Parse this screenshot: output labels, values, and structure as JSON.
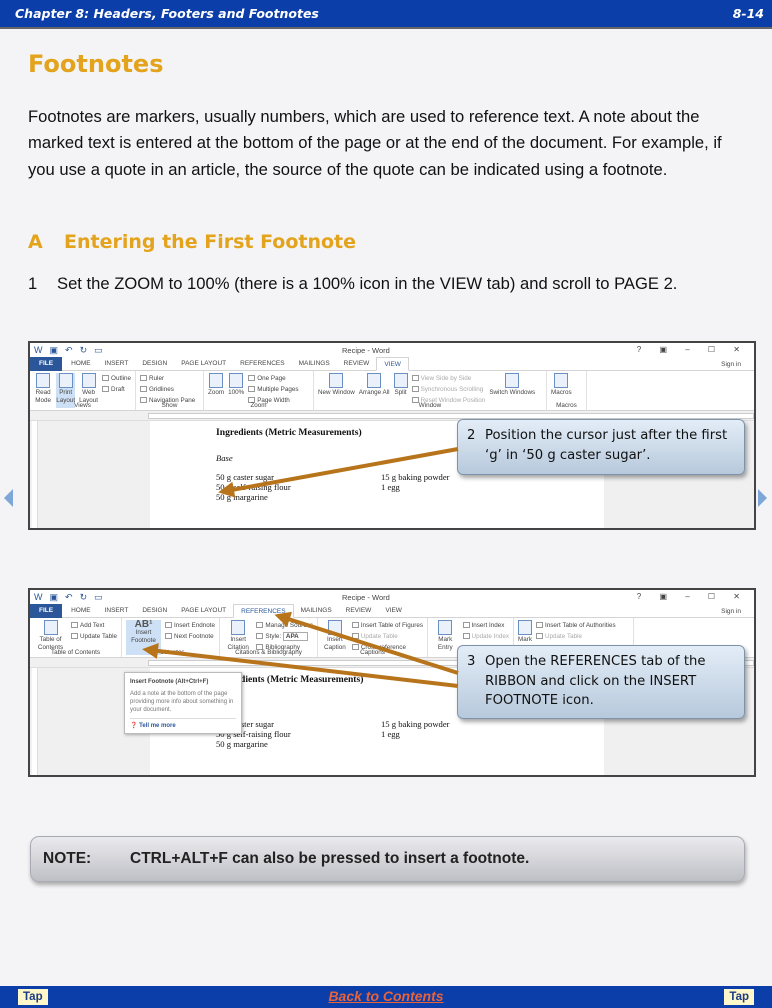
{
  "header": {
    "chapter": "Chapter 8: Headers, Footers and Footnotes",
    "page": "8-14"
  },
  "title": "Footnotes",
  "intro": "Footnotes are markers, usually numbers, which are used to reference text.  A note about the marked text is entered at the bottom of the page or at the end of the document.  For example, if you use a quote in an article, the source of the quote can be indicated using a footnote.",
  "section": {
    "letter": "A",
    "title": "Entering the First Footnote"
  },
  "step1": {
    "num": "1",
    "text": "Set the ZOOM to 100% (there is a 100% icon in the VIEW tab) and scroll to PAGE 2."
  },
  "word": {
    "window_title": "Recipe - Word",
    "controls": "? ▣ – ☐ ✕",
    "sign_in": "Sign in",
    "tabs": [
      "FILE",
      "HOME",
      "INSERT",
      "DESIGN",
      "PAGE LAYOUT",
      "REFERENCES",
      "MAILINGS",
      "REVIEW",
      "VIEW"
    ],
    "doc": {
      "heading": "Ingredients (Metric Measurements)",
      "heading_partial": "dients (Metric Measurements)",
      "base": "Base",
      "r1a": "50 g caster sugar",
      "r1b": "15 g baking powder",
      "r2a": "50 g self-raising flour",
      "r2b": "1 egg",
      "r3a": "50 g margarine"
    }
  },
  "shot1": {
    "active_tab": "VIEW",
    "views": {
      "label": "Views",
      "read": "Read Mode",
      "print": "Print Layout",
      "web": "Web Layout",
      "outline": "Outline",
      "draft": "Draft"
    },
    "show": {
      "label": "Show",
      "ruler": "Ruler",
      "gridlines": "Gridlines",
      "nav": "Navigation Pane"
    },
    "zoom": {
      "label": "Zoom",
      "zoom": "Zoom",
      "pct": "100%",
      "one": "One Page",
      "multi": "Multiple Pages",
      "width": "Page Width"
    },
    "window": {
      "label": "Window",
      "new": "New Window",
      "arrange": "Arrange All",
      "split": "Split",
      "side": "View Side by Side",
      "sync": "Synchronous Scrolling",
      "reset": "Reset Window Position",
      "switch": "Switch Windows"
    },
    "macros": {
      "label": "Macros",
      "macros": "Macros"
    }
  },
  "callout2": {
    "num": "2",
    "text": "Position the cursor just after the first ‘g’ in ‘50 g caster sugar’."
  },
  "shot2": {
    "active_tab": "REFERENCES",
    "toc": {
      "label": "Table of Contents",
      "toc": "Table of Contents",
      "add": "Add Text",
      "update": "Update Table"
    },
    "fn": {
      "label": "Footnotes",
      "insert": "Insert Footnote",
      "endnote": "Insert Endnote",
      "next": "Next Footnote"
    },
    "cit": {
      "label": "Citations & Bibliography",
      "insert": "Insert Citation",
      "manage": "Manage Sources",
      "style": "Style:",
      "style_val": "APA",
      "bib": "Bibliography"
    },
    "cap": {
      "label": "Captions",
      "insert": "Insert Caption",
      "tof": "Insert Table of Figures",
      "update": "Update Table",
      "cross": "Cross-reference"
    },
    "idx": {
      "mark": "Mark Entry",
      "insert": "Insert Index",
      "update": "Update Index"
    },
    "toa": {
      "mark": "Mark",
      "insert": "Insert Table of Authorities",
      "update": "Update Table"
    },
    "tooltip": {
      "title": "Insert Footnote (Alt+Ctrl+F)",
      "body": "Add a note at the bottom of the page providing more info about something in your document.",
      "link": "Tell me more"
    }
  },
  "callout3": {
    "num": "3",
    "text": "Open the REFERENCES tab of the RIBBON and click on the INSERT FOOTNOTE icon."
  },
  "note": {
    "label": "NOTE:",
    "text": "CTRL+ALT+F can also be pressed to insert a footnote."
  },
  "footer": {
    "back": "Back to Contents",
    "tap_left": "Tap",
    "tap_right": "Tap"
  },
  "colors": {
    "bar": "#0b3ea8",
    "heading": "#e3a31c",
    "arrow": "#b8741a",
    "link": "#e8623a"
  }
}
